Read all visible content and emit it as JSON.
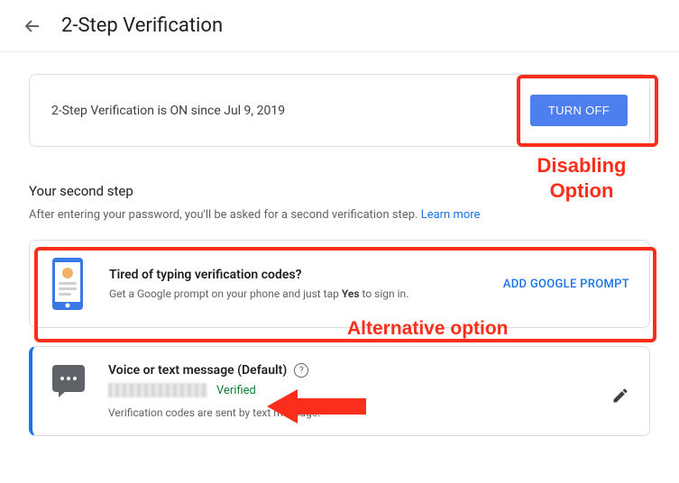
{
  "header": {
    "title": "2-Step Verification"
  },
  "status_card": {
    "text": "2-Step Verification is ON since Jul 9, 2019",
    "turn_off": "TURN OFF"
  },
  "second_step": {
    "heading": "Your second step",
    "subtext": "After entering your password, you'll be asked for a second verification step. ",
    "learn_more": "Learn more"
  },
  "prompt_card": {
    "title": "Tired of typing verification codes?",
    "desc_pre": "Get a Google prompt on your phone and just tap ",
    "desc_bold": "Yes",
    "desc_post": " to sign in.",
    "cta": "ADD GOOGLE PROMPT"
  },
  "voice_card": {
    "title": "Voice or text message (Default)",
    "verified": "Verified",
    "desc": "Verification codes are sent by text message."
  },
  "annotations": {
    "disabling": "Disabling Option",
    "alternative": "Alternative option"
  }
}
